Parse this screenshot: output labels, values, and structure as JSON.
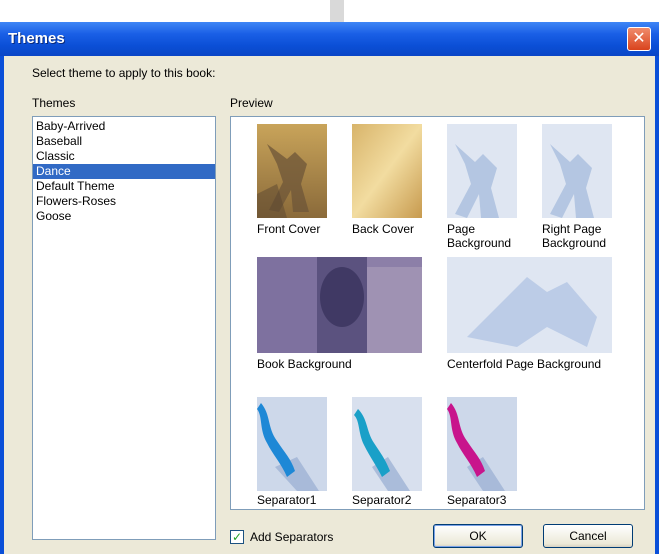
{
  "window": {
    "title": "Themes",
    "close_glyph": "✕"
  },
  "dialog": {
    "prompt": "Select theme to apply to this book:",
    "themes_label": "Themes",
    "preview_label": "Preview"
  },
  "themes": [
    {
      "label": "Baby-Arrived",
      "selected": false
    },
    {
      "label": "Baseball",
      "selected": false
    },
    {
      "label": "Classic",
      "selected": false
    },
    {
      "label": "Dance",
      "selected": true
    },
    {
      "label": "Default Theme",
      "selected": false
    },
    {
      "label": "Flowers-Roses",
      "selected": false
    },
    {
      "label": "Goose",
      "selected": false
    }
  ],
  "preview": {
    "front_cover": "Front Cover",
    "back_cover": "Back Cover",
    "page_background": "Page\nBackground",
    "right_page_background": "Right Page\nBackground",
    "book_background": "Book Background",
    "centerfold_background": "Centerfold Page Background",
    "separator1": "Separator1",
    "separator2": "Separator2",
    "separator3": "Separator3"
  },
  "add_separators": {
    "label": "Add Separators",
    "checked": true,
    "check_glyph": "✓"
  },
  "buttons": {
    "ok": "OK",
    "cancel": "Cancel"
  },
  "colors": {
    "selection": "#316ac5",
    "titlebar": "#0a4fd8",
    "dialog_bg": "#ece9d8"
  }
}
